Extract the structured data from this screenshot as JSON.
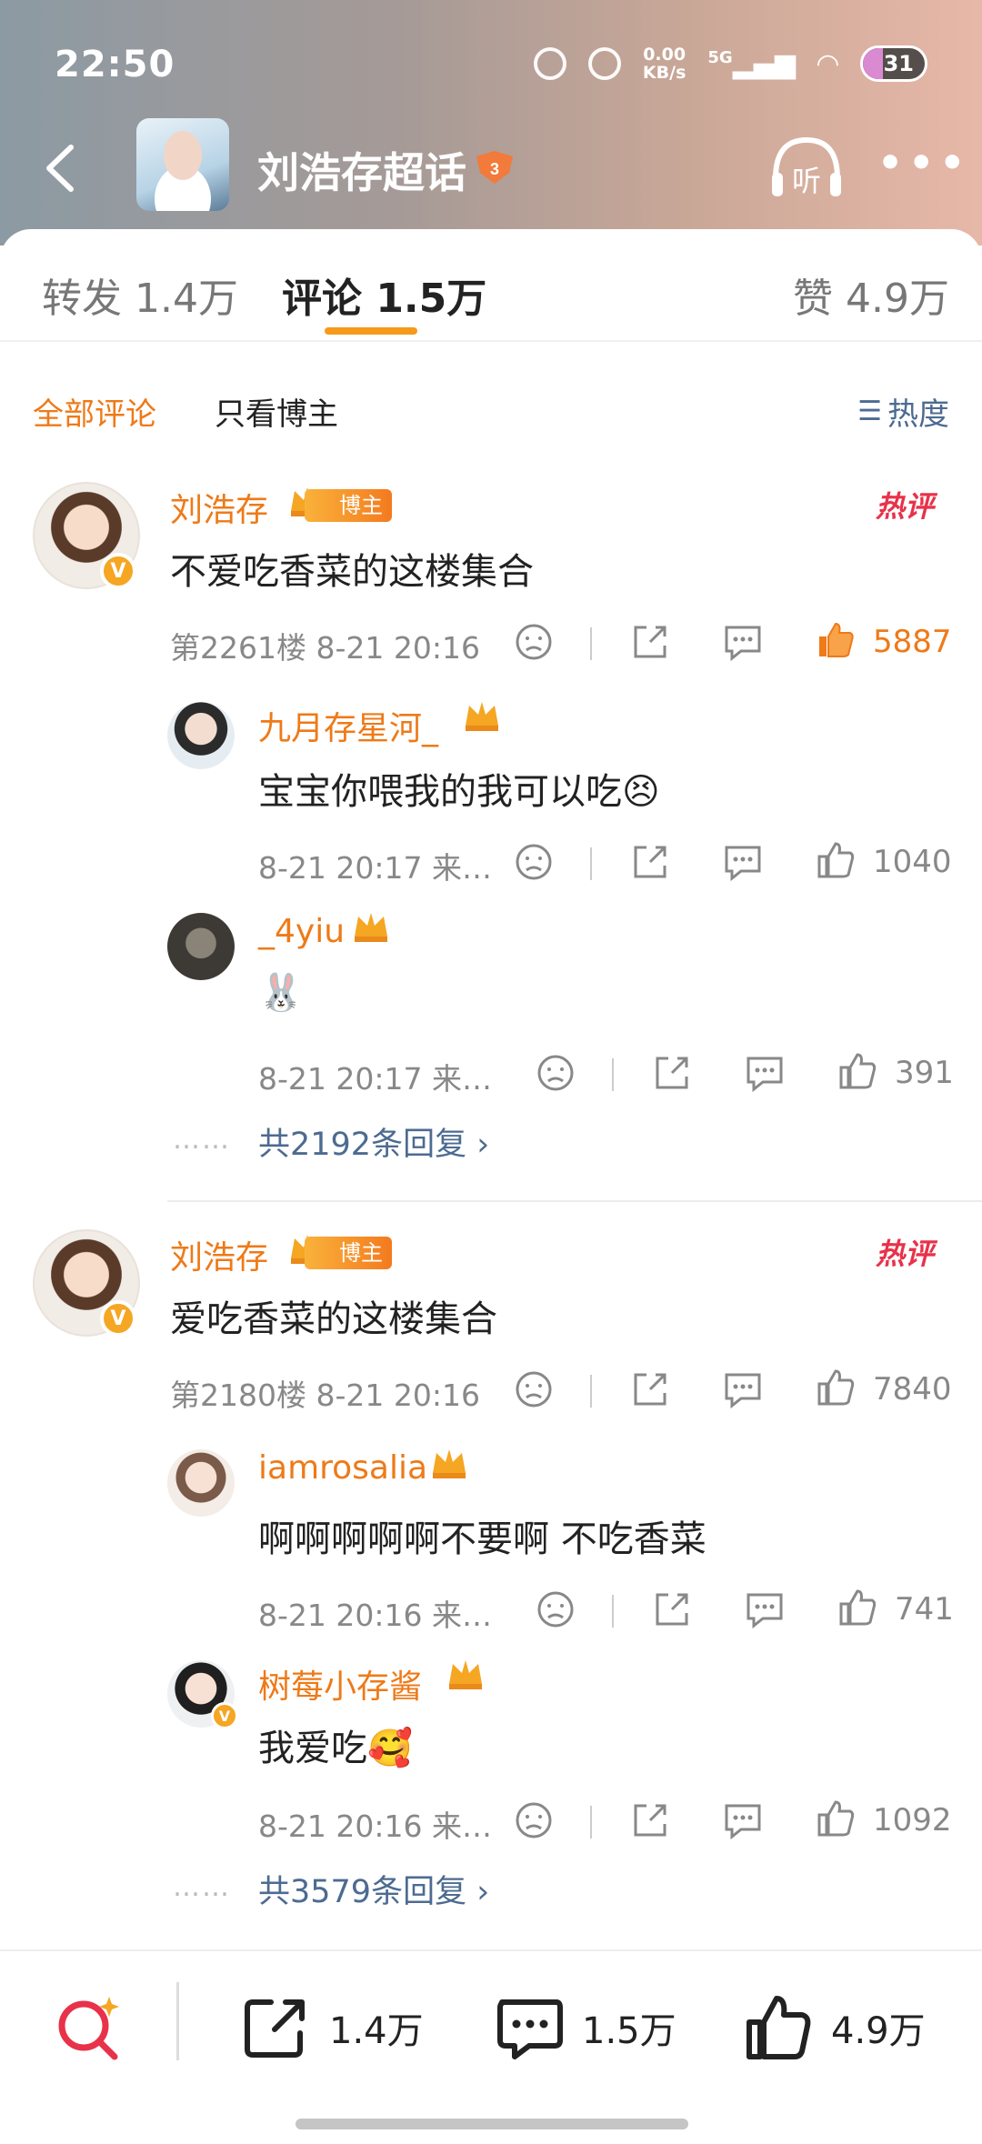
{
  "status": {
    "time": "22:50",
    "net_speed": "0.00",
    "net_unit": "KB/s",
    "network": "5G",
    "battery": "31"
  },
  "nav": {
    "title": "刘浩存超话",
    "listen_label": "听"
  },
  "tabs": [
    {
      "label": "转发 1.4万"
    },
    {
      "label": "评论 1.5万"
    },
    {
      "label": "赞 4.9万"
    }
  ],
  "filters": {
    "all": "全部评论",
    "author_only": "只看博主",
    "sort": "热度"
  },
  "comments": [
    {
      "name": "刘浩存",
      "author_badge": "博主",
      "hot_label": "热评",
      "text": "不爱吃香菜的这楼集合",
      "meta": "第2261楼 8-21 20:16",
      "likes": "5887",
      "replies": [
        {
          "name": "九月存星河_",
          "text": "宝宝你喂我的我可以吃😣",
          "meta": "8-21 20:17 来…",
          "likes": "1040"
        },
        {
          "name": "_4yiu",
          "text": "🐰",
          "meta": "8-21 20:17 来…",
          "likes": "391"
        }
      ],
      "more_replies": "共2192条回复 ›",
      "dots": "……"
    },
    {
      "name": "刘浩存",
      "author_badge": "博主",
      "hot_label": "热评",
      "text": "爱吃香菜的这楼集合",
      "meta": "第2180楼 8-21 20:16",
      "likes": "7840",
      "replies": [
        {
          "name": "iamrosalia",
          "text": "啊啊啊啊啊不要啊 不吃香菜",
          "meta": "8-21 20:16 来…",
          "likes": "741"
        },
        {
          "name": "树莓小存酱",
          "text": "我爱吃🥰",
          "meta": "8-21 20:16 来…",
          "likes": "1092"
        }
      ],
      "more_replies": "共3579条回复 ›",
      "dots": "……"
    }
  ],
  "bottom": {
    "repost": "1.4万",
    "comment": "1.5万",
    "like": "4.9万"
  },
  "colors": {
    "accent": "#ee7a18",
    "link": "#4d6b91",
    "hot": "#e8324a"
  }
}
